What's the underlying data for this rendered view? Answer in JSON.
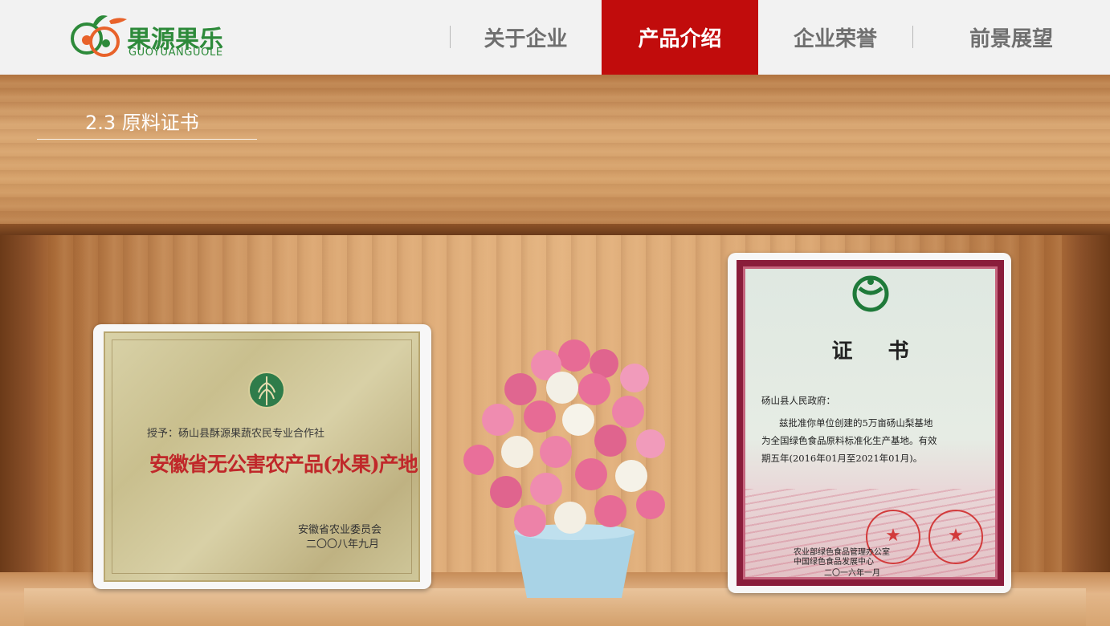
{
  "header": {
    "logo_cn": "果源果乐",
    "logo_en": "GUOYUANGUOLE",
    "nav": [
      {
        "label": "关于企业",
        "active": false
      },
      {
        "label": "产品介绍",
        "active": true
      },
      {
        "label": "企业荣誉",
        "active": false
      },
      {
        "label": "前景展望",
        "active": false
      }
    ]
  },
  "section": {
    "title": "2.3 原料证书"
  },
  "certificate_plaque": {
    "recipient": "授予：砀山县酥源果蔬农民专业合作社",
    "title": "安徽省无公害农产品(水果)产地",
    "issuer": "安徽省农业委员会",
    "date": "二〇〇八年九月"
  },
  "certificate_green": {
    "heading": "证书",
    "addressee": "砀山县人民政府：",
    "body_line1": "兹批准你单位创建的5万亩砀山梨基地",
    "body_line2": "为全国绿色食品原料标准化生产基地。有效",
    "body_line3": "期五年(2016年01月至2021年01月)。",
    "issuer1": "农业部绿色食品管理办公室",
    "issuer2": "中国绿色食品发展中心",
    "date": "二〇一六年一月"
  },
  "colors": {
    "nav_active_bg": "#c10c0c",
    "logo_green": "#2d8a3a",
    "logo_orange": "#e8622a"
  }
}
